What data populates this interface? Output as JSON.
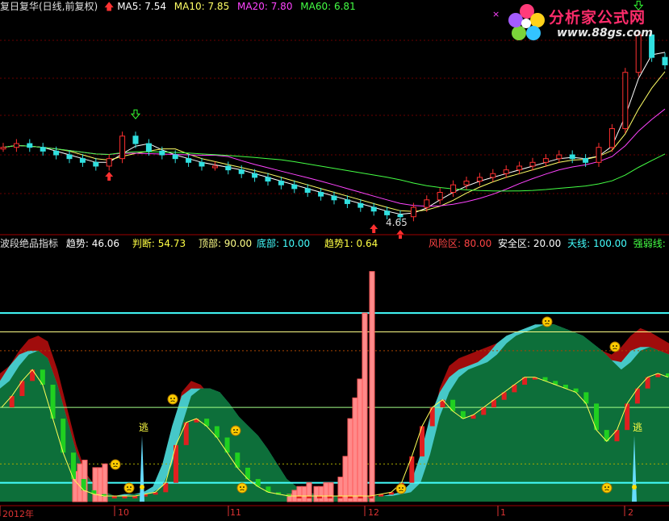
{
  "top_header": {
    "stock": "复日复华(日线,前复权)",
    "ma5": "MA5: 7.54",
    "ma10": "MA10: 7.85",
    "ma20": "MA20: 7.80",
    "ma60": "MA60: 6.81",
    "colors": {
      "stock": "#e0e0e0",
      "ma5": "#ffffff",
      "ma10": "#ffff66",
      "ma20": "#ff44ff",
      "ma60": "#44ff44"
    }
  },
  "low_label": "4.65",
  "indicator_header": {
    "name": "波段绝品指标",
    "trend": "趋势: 46.06",
    "judge": "判断: 54.73",
    "top": "顶部: 90.00",
    "bottom": "底部: 10.00",
    "trend1": "趋势1: 0.64",
    "risk": "风险区: 80.00",
    "safe": "安全区: 20.00",
    "sky": "天线: 100.00",
    "strong": "强弱线: 50.00"
  },
  "watermark": {
    "title": "分析家公式网",
    "url": "www.88gs.com"
  },
  "date_axis": [
    "2012年",
    "10",
    "11",
    "12",
    "1",
    "2"
  ],
  "escape_labels": [
    "逃",
    "逃"
  ],
  "chart_data": [
    {
      "type": "candlestick",
      "title": "复日复华(日线,前复权)",
      "low_marker": 4.65,
      "series_names": [
        "MA5",
        "MA10",
        "MA20",
        "MA60"
      ],
      "close_approx": [
        6.5,
        6.6,
        6.5,
        6.4,
        6.3,
        6.2,
        6.1,
        6.0,
        6.2,
        6.8,
        6.6,
        6.4,
        6.3,
        6.2,
        6.1,
        6.0,
        6.0,
        5.9,
        5.8,
        5.7,
        5.6,
        5.5,
        5.4,
        5.3,
        5.2,
        5.1,
        5.0,
        4.9,
        4.8,
        4.7,
        4.65,
        4.9,
        5.1,
        5.3,
        5.5,
        5.6,
        5.7,
        5.8,
        5.9,
        6.0,
        6.1,
        6.2,
        6.3,
        6.2,
        6.1,
        6.5,
        7.0,
        8.5,
        9.5,
        8.9,
        8.7
      ]
    },
    {
      "type": "area",
      "title": "波段绝品指标",
      "levels": {
        "风险区": 80,
        "安全区": 20,
        "天线": 100,
        "强弱线": 50,
        "顶部": 90,
        "底部": 10
      },
      "ylim": [
        0,
        130
      ],
      "trend_red": [
        68,
        72,
        80,
        86,
        88,
        85,
        70,
        50,
        30,
        15,
        8,
        5,
        3,
        3,
        4,
        4,
        5,
        10,
        35,
        58,
        64,
        62,
        56,
        48,
        42,
        35,
        30,
        25,
        18,
        10,
        6,
        4,
        3,
        3,
        3,
        3,
        3,
        3,
        3,
        3,
        3,
        3,
        4,
        5,
        12,
        35,
        60,
        72,
        76,
        78,
        80,
        82,
        84,
        86,
        88,
        90,
        92,
        94,
        92,
        90,
        88,
        85,
        82,
        80,
        78,
        82,
        88,
        92,
        90,
        87,
        84
      ],
      "trend_green": [
        60,
        64,
        72,
        78,
        80,
        76,
        62,
        44,
        26,
        14,
        8,
        5,
        3,
        3,
        4,
        4,
        5,
        8,
        20,
        40,
        56,
        60,
        60,
        58,
        52,
        45,
        40,
        35,
        28,
        20,
        12,
        8,
        5,
        4,
        3,
        3,
        3,
        3,
        3,
        3,
        3,
        3,
        4,
        5,
        10,
        25,
        45,
        58,
        66,
        70,
        72,
        74,
        78,
        84,
        88,
        90,
        92,
        94,
        94,
        92,
        90,
        88,
        84,
        80,
        75,
        70,
        74,
        80,
        82,
        80,
        78
      ],
      "judge_segments": [
        50,
        56,
        64,
        70,
        62,
        44,
        26,
        12,
        6,
        4,
        3,
        3,
        3,
        3,
        4,
        5,
        10,
        30,
        42,
        44,
        40,
        34,
        26,
        18,
        12,
        8,
        5,
        4,
        3,
        3,
        3,
        3,
        3,
        3,
        3,
        3,
        3,
        4,
        5,
        10,
        24,
        40,
        50,
        54,
        48,
        44,
        46,
        50,
        54,
        58,
        62,
        66,
        66,
        64,
        62,
        60,
        58,
        52,
        38,
        32,
        38,
        52,
        60,
        66,
        68,
        66
      ],
      "pink_bars": [
        {
          "x": 93,
          "v": 16
        },
        {
          "x": 99,
          "v": 20
        },
        {
          "x": 105,
          "v": 22
        },
        {
          "x": 118,
          "v": 18
        },
        {
          "x": 124,
          "v": 18
        },
        {
          "x": 130,
          "v": 20
        },
        {
          "x": 359,
          "v": 4
        },
        {
          "x": 365,
          "v": 6
        },
        {
          "x": 371,
          "v": 8
        },
        {
          "x": 377,
          "v": 8
        },
        {
          "x": 383,
          "v": 10
        },
        {
          "x": 392,
          "v": 8
        },
        {
          "x": 398,
          "v": 8
        },
        {
          "x": 404,
          "v": 10
        },
        {
          "x": 410,
          "v": 10
        },
        {
          "x": 422,
          "v": 13
        },
        {
          "x": 428,
          "v": 24
        },
        {
          "x": 434,
          "v": 44
        },
        {
          "x": 440,
          "v": 55
        },
        {
          "x": 446,
          "v": 65
        },
        {
          "x": 452,
          "v": 100
        },
        {
          "x": 461,
          "v": 122
        }
      ]
    }
  ]
}
